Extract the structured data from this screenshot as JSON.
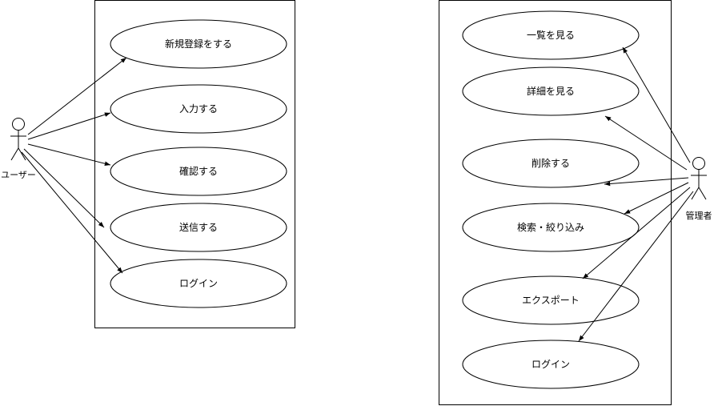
{
  "user_actor": {
    "label": "ユーザー"
  },
  "admin_actor": {
    "label": "管理者"
  },
  "user_usecases": [
    {
      "label": "新規登録をする"
    },
    {
      "label": "入力する"
    },
    {
      "label": "確認する"
    },
    {
      "label": "送信する"
    },
    {
      "label": "ログイン"
    }
  ],
  "admin_usecases": [
    {
      "label": "一覧を見る"
    },
    {
      "label": "詳細を見る"
    },
    {
      "label": "削除する"
    },
    {
      "label": "検索・絞り込み"
    },
    {
      "label": "エクスポート"
    },
    {
      "label": "ログイン"
    }
  ]
}
